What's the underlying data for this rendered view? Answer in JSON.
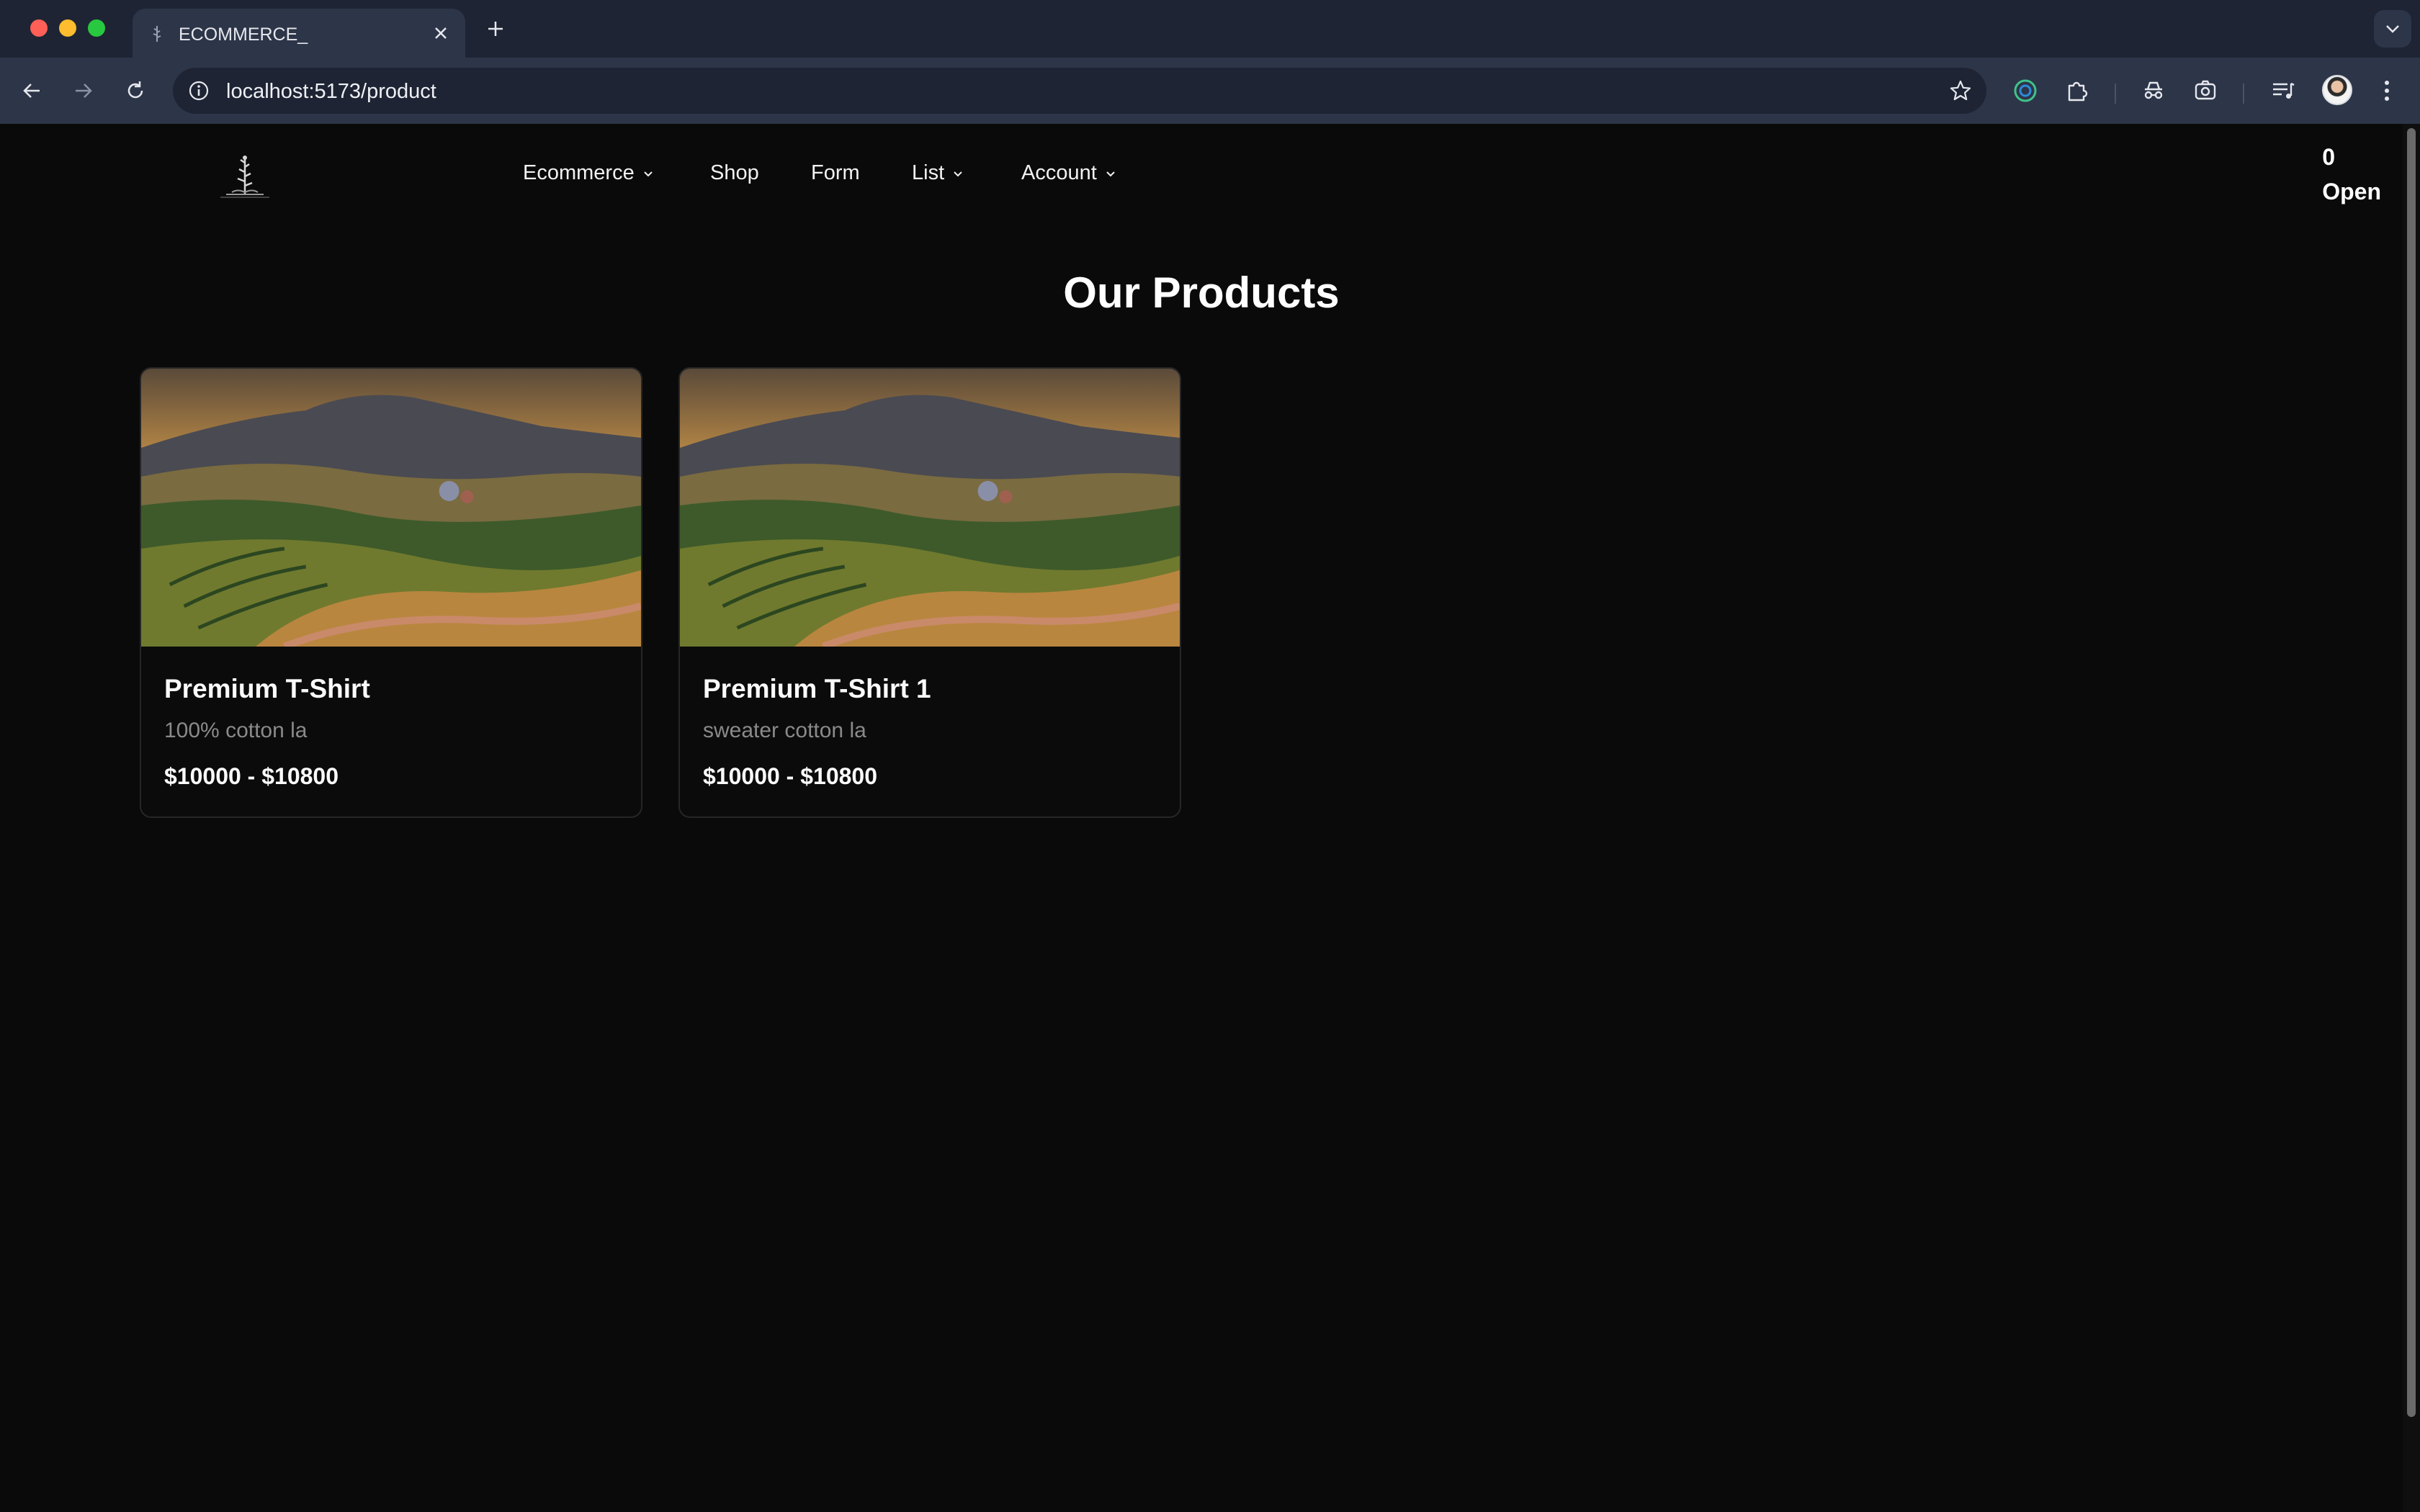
{
  "browser": {
    "tab_title": "ECOMMERCE_",
    "url": "localhost:5173/product",
    "icons": [
      "back-icon",
      "forward-icon",
      "reload-icon",
      "info-icon",
      "star-icon",
      "extension-ring-icon",
      "puzzle-icon",
      "incognito-icon",
      "screenshot-icon",
      "media-icon",
      "avatar",
      "kebab-menu-icon"
    ]
  },
  "nav": {
    "items": [
      {
        "label": "Ecommerce",
        "has_dropdown": true
      },
      {
        "label": "Shop",
        "has_dropdown": false
      },
      {
        "label": "Form",
        "has_dropdown": false
      },
      {
        "label": "List",
        "has_dropdown": true
      },
      {
        "label": "Account",
        "has_dropdown": true
      }
    ]
  },
  "cart": {
    "count": "0",
    "label": "Open"
  },
  "main": {
    "heading": "Our Products",
    "products": [
      {
        "title": "Premium T-Shirt",
        "description": "100% cotton la",
        "price": "$10000 - $10800"
      },
      {
        "title": "Premium T-Shirt 1",
        "description": "sweater cotton la",
        "price": "$10000 - $10800"
      }
    ]
  },
  "colors": {
    "page_bg": "#0a0a0a",
    "chrome_bg": "#1e2433",
    "toolbar_bg": "#2d3548",
    "card_border": "#262626",
    "muted_text": "#8a8a8a"
  }
}
